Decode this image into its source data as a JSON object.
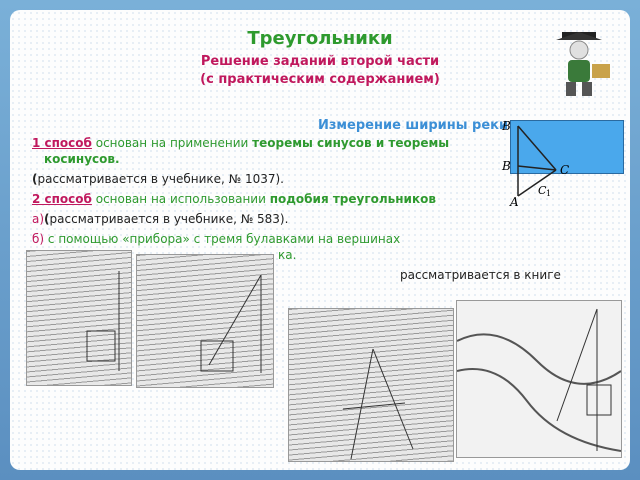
{
  "title": "Треугольники",
  "subtitle_1": "Решение заданий второй части",
  "subtitle_2": "(с практическим содержанием)",
  "section": "Измерение ширины реки",
  "m1_num": "1 способ",
  "m1_text": " основан на применении ",
  "m1_bold": "теоремы синусов и теоремы",
  "m1_bold2": "косинусов.",
  "m1_ref_paren": "(",
  "m1_ref": "рассматривается в учебнике, № 1037).",
  "m2_num": "2 способ",
  "m2_text": " основан на использовании ",
  "m2_bold": "подобия треугольников",
  "a_label": "а)",
  "a_paren": "(",
  "a_ref": "рассматривается в учебнике, № 583).",
  "b_label": "б)",
  "b_text": " с помощью «прибора» с тремя булавками на вершинах",
  "b_text2": "ка.",
  "book_text": "рассматривается в книге",
  "labels": {
    "B": "B",
    "C": "C",
    "B1": "B",
    "C1": "C",
    "A": "A",
    "sub1": "1"
  },
  "colors": {
    "title": "#2e9a2e",
    "subtitle": "#c0185d",
    "section": "#3c8fd6",
    "river": "#4aa8ec"
  }
}
